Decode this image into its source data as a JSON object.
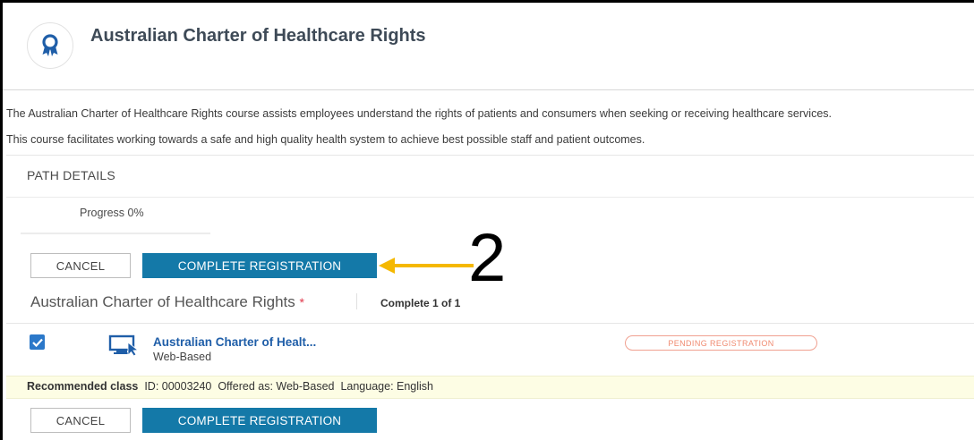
{
  "header": {
    "title": "Australian Charter of Healthcare Rights",
    "logo_icon": "award-ribbon-icon"
  },
  "description": {
    "line1": "The Australian Charter of Healthcare Rights course assists employees understand the rights of patients and consumers when seeking or receiving healthcare services.",
    "line2": "This course facilitates working towards a safe and high quality health system to achieve best possible staff and patient outcomes."
  },
  "path_details": {
    "label": "PATH DETAILS",
    "progress_text": "Progress 0%",
    "progress_value": 0
  },
  "buttons": {
    "cancel": "CANCEL",
    "complete": "COMPLETE REGISTRATION"
  },
  "annotation": {
    "number": "2",
    "arrow_color": "#f5b800"
  },
  "course": {
    "name": "Australian Charter of Healthcare Rights",
    "required_mark": "*",
    "complete_count": "Complete 1 of 1"
  },
  "item": {
    "checked": true,
    "icon": "monitor-cursor-icon",
    "title": "Australian Charter of Healt...",
    "subtitle": "Web-Based",
    "status": "PENDING REGISTRATION"
  },
  "recommended": {
    "label": "Recommended class",
    "id_text": "ID: 00003240",
    "offered": "Offered as: Web-Based",
    "language": "Language: English"
  },
  "colors": {
    "primary_button": "#1479a8",
    "title_link": "#1f5ea8",
    "status_badge": "#f08a70",
    "recommended_bg": "#fdfde4",
    "checkbox": "#2b78c9"
  }
}
